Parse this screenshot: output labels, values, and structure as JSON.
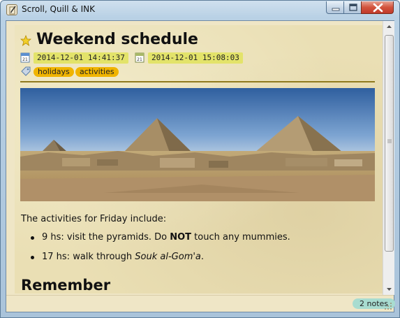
{
  "window": {
    "title": "Scroll, Quill & INK",
    "app_icon": "scroll-quill-icon"
  },
  "note": {
    "title": "Weekend schedule",
    "title_icon": "star-icon",
    "created": "2014-12-01 14:41:37",
    "modified": "2014-12-01 15:08:03",
    "tags": [
      "holidays",
      "activities"
    ],
    "image_alt_icon": "pyramids-photo"
  },
  "content": {
    "intro": "The activities for Friday include:",
    "bullets": [
      {
        "prefix": "9 hs: visit the pyramids. Do ",
        "bold": "NOT",
        "suffix": " touch any mummies."
      },
      {
        "prefix": "17 hs: walk through ",
        "italic": "Souk al-Gom'a",
        "suffix": "."
      }
    ],
    "heading": "Remember"
  },
  "statusbar": {
    "note_count": "2 notes"
  },
  "colors": {
    "paper": "#eadfb4",
    "date_chip": "#e3e36a",
    "tag": "#f0b400",
    "divider": "#8f7a1e",
    "badge": "#a8dcd0"
  }
}
